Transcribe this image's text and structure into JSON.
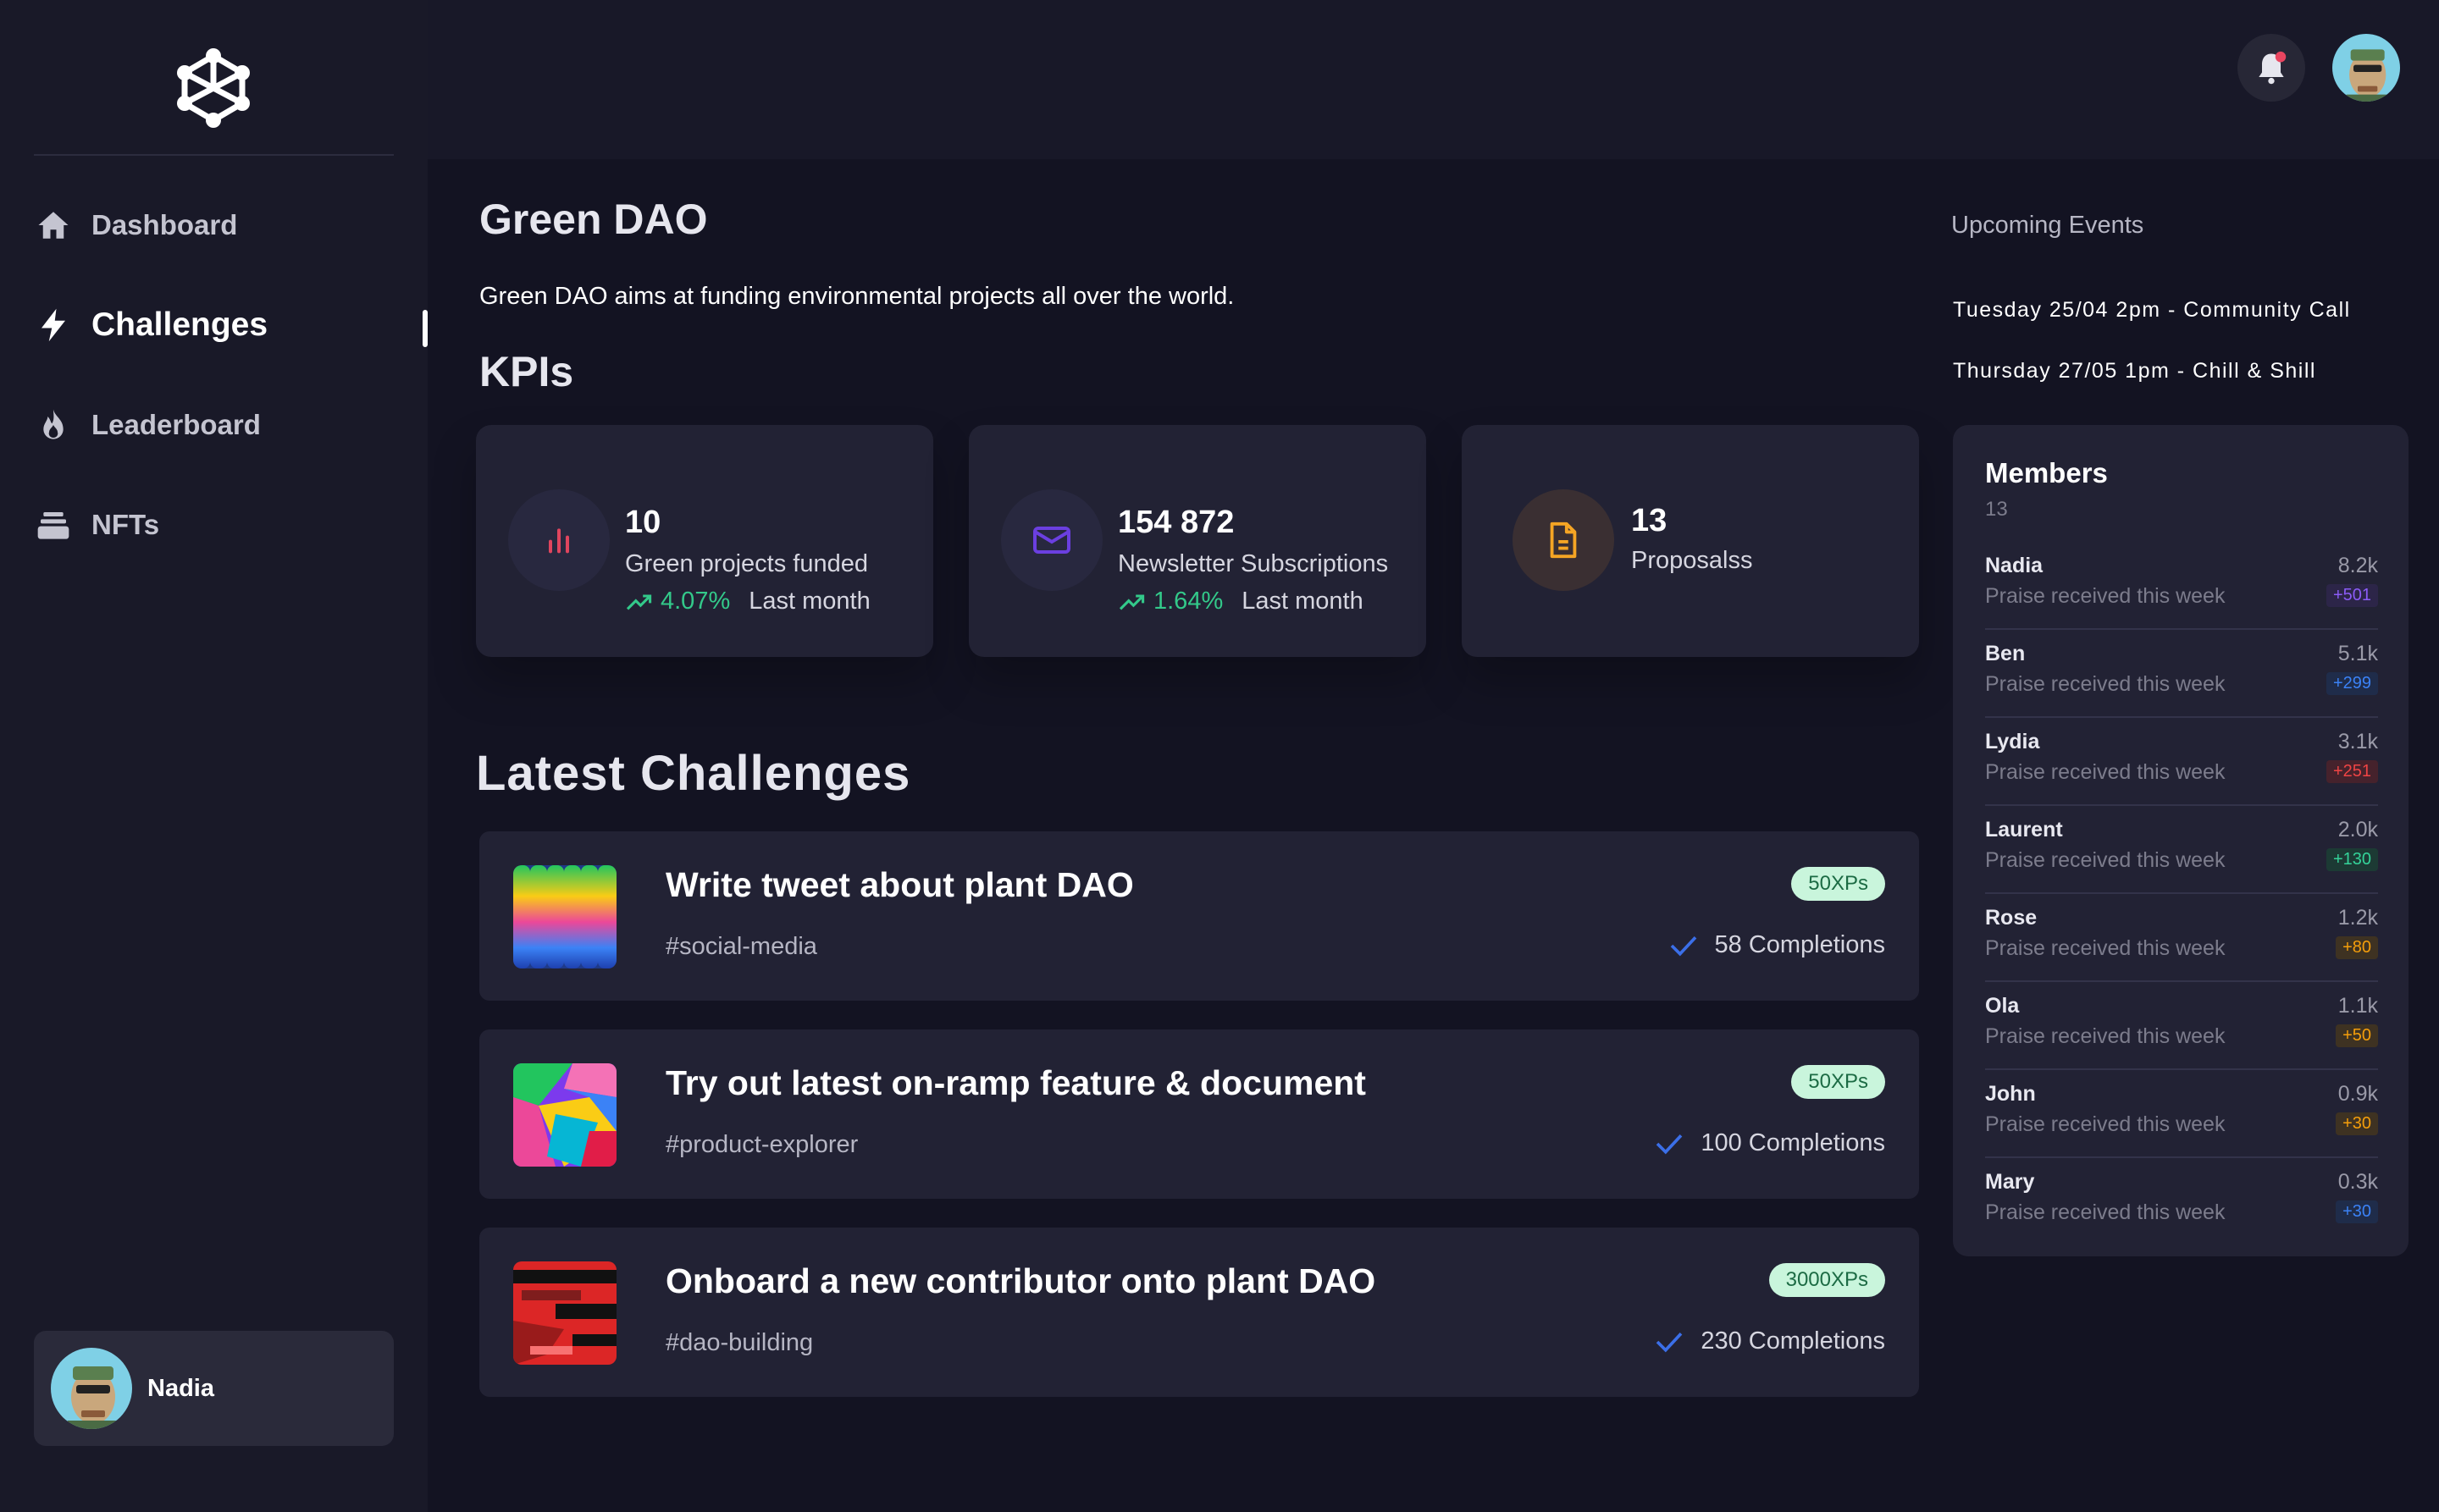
{
  "sidebar": {
    "nav": [
      {
        "label": "Dashboard",
        "icon": "home-icon"
      },
      {
        "label": "Challenges",
        "icon": "lightning-icon",
        "active": true
      },
      {
        "label": "Leaderboard",
        "icon": "fire-icon"
      },
      {
        "label": "NFTs",
        "icon": "stack-icon"
      }
    ],
    "user": {
      "name": "Nadia"
    }
  },
  "header": {
    "notification": true
  },
  "main": {
    "title": "Green DAO",
    "description": "Green DAO aims at funding environmental projects all over the world.",
    "kpi_heading": "KPIs",
    "kpis": [
      {
        "value": "10",
        "label": "Green projects funded",
        "trend": "4.07%",
        "period": "Last month",
        "icon": "bar-chart-icon",
        "color": "#e0455e"
      },
      {
        "value": "154 872",
        "label": "Newsletter Subscriptions",
        "trend": "1.64%",
        "period": "Last month",
        "icon": "envelope-icon",
        "color": "#6b3fe0"
      },
      {
        "value": "13",
        "label": "Proposalss",
        "icon": "document-icon",
        "color": "#f5a524"
      }
    ],
    "challenges_heading": "Latest Challenges",
    "challenges": [
      {
        "title": "Write tweet about plant DAO",
        "tag": "#social-media",
        "xp": "50XPs",
        "completions": "58 Completions"
      },
      {
        "title": "Try out latest on-ramp feature & document",
        "tag": "#product-explorer",
        "xp": "50XPs",
        "completions": "100 Completions"
      },
      {
        "title": "Onboard a new contributor onto plant DAO",
        "tag": "#dao-building",
        "xp": "3000XPs",
        "completions": "230 Completions"
      }
    ]
  },
  "events": {
    "title": "Upcoming Events",
    "items": [
      "Tuesday 25/04 2pm - Community Call",
      "Thursday 27/05 1pm - Chill & Shill"
    ]
  },
  "members": {
    "title": "Members",
    "count": "13",
    "rows": [
      {
        "name": "Nadia",
        "sub": "Praise received this week",
        "score": "8.2k",
        "badge": "+501",
        "badge_color": "#8b5cf6",
        "badge_bg": "#2c2548"
      },
      {
        "name": "Ben",
        "sub": "Praise received this week",
        "score": "5.1k",
        "badge": "+299",
        "badge_color": "#3b82f6",
        "badge_bg": "#1f2c4a"
      },
      {
        "name": "Lydia",
        "sub": "Praise received this week",
        "score": "3.1k",
        "badge": "+251",
        "badge_color": "#ef4444",
        "badge_bg": "#45222c"
      },
      {
        "name": "Laurent",
        "sub": "Praise received this week",
        "score": "2.0k",
        "badge": "+130",
        "badge_color": "#34d399",
        "badge_bg": "#1c3a34"
      },
      {
        "name": "Rose",
        "sub": "Praise received this week",
        "score": "1.2k",
        "badge": "+80",
        "badge_color": "#f59e0b",
        "badge_bg": "#3e3222"
      },
      {
        "name": "Ola",
        "sub": "Praise received this week",
        "score": "1.1k",
        "badge": "+50",
        "badge_color": "#f59e0b",
        "badge_bg": "#3e3222"
      },
      {
        "name": "John",
        "sub": "Praise received this week",
        "score": "0.9k",
        "badge": "+30",
        "badge_color": "#f59e0b",
        "badge_bg": "#3e3222"
      },
      {
        "name": "Mary",
        "sub": "Praise received this week",
        "score": "0.3k",
        "badge": "+30",
        "badge_color": "#3b82f6",
        "badge_bg": "#1f2c4a"
      }
    ]
  }
}
